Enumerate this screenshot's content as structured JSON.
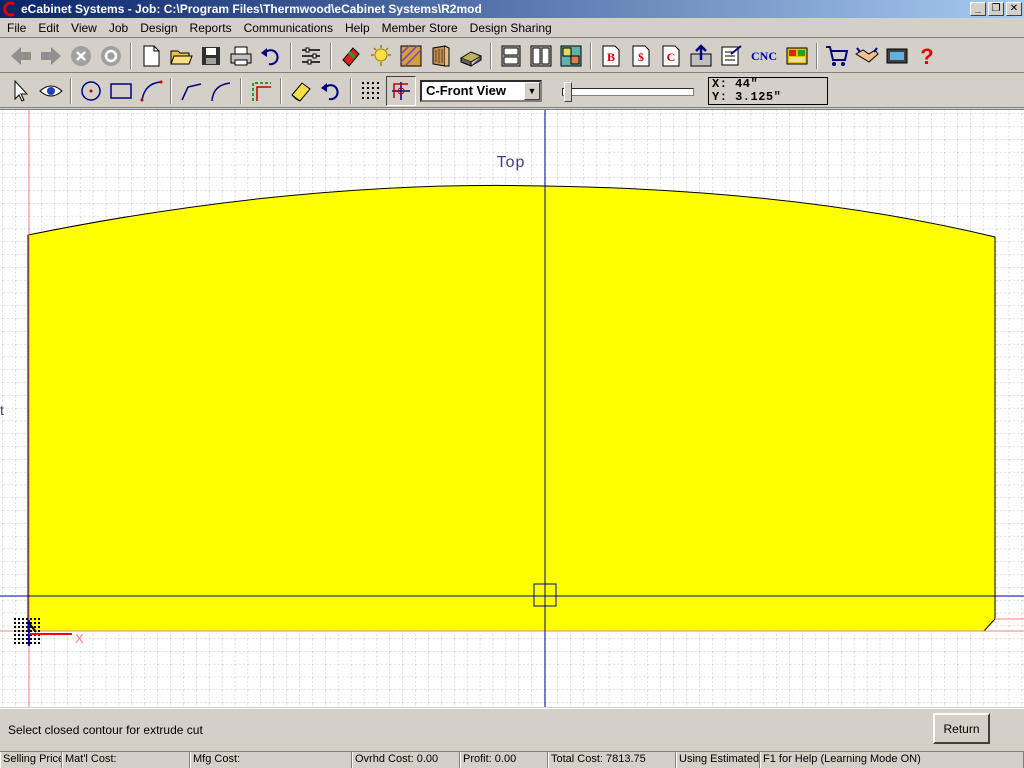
{
  "window": {
    "title": "eCabinet Systems - Job: C:\\Program Files\\Thermwood\\eCabinet Systems\\R2mod",
    "minimize_glyph": "_",
    "restore_glyph": "❐",
    "close_glyph": "✕"
  },
  "menu": {
    "items": [
      "File",
      "Edit",
      "View",
      "Job",
      "Design",
      "Reports",
      "Communications",
      "Help",
      "Member Store",
      "Design Sharing"
    ]
  },
  "toolbar1": {
    "icons": [
      "back-arrow-icon",
      "forward-arrow-icon",
      "stop-icon",
      "refresh-icon",
      "new-file-icon",
      "open-folder-icon",
      "save-icon",
      "print-icon",
      "undo-icon",
      "settings-sliders-icon",
      "paint-tool-icon",
      "light-icon",
      "texture-icon",
      "door-icon",
      "panel-icon",
      "cabinet-icon",
      "cabinet-double-icon",
      "layout-icon",
      "bill-report-icon",
      "cost-report-icon",
      "cut-report-icon",
      "assembly-icon",
      "checklist-icon",
      "cnc-icon",
      "color-grid-icon",
      "shopping-cart-icon",
      "handshake-icon",
      "film-icon",
      "help-icon"
    ],
    "labels": {
      "bill_report": "B",
      "cost_report": "$",
      "cut_report": "C",
      "cnc": "CNC",
      "help": "?"
    }
  },
  "toolbar2": {
    "view_select": {
      "value": "C-Front View",
      "arrow": "▼"
    },
    "slider": {
      "value": 0
    },
    "coords": {
      "x": "X: 44\"",
      "y": "Y: 3.125\""
    }
  },
  "canvas": {
    "view_label": "Top",
    "left_edge_label": "t",
    "axis_label": "X",
    "panel_color": "#ffff00",
    "grid_color": "#c0c0c0",
    "crosshair_color": "#0000a0",
    "origin_color": "#ff0000"
  },
  "prompt": {
    "text": "Select closed contour for extrude cut",
    "return_label": "Return"
  },
  "status": {
    "cells": [
      "Selling Price:",
      "Mat'l Cost:",
      "Mfg Cost:",
      "Ovrhd Cost: 0.00",
      "Profit: 0.00",
      "Total Cost: 7813.75",
      "Using Estimated Yield",
      "F1 for Help (Learning Mode ON)"
    ]
  }
}
